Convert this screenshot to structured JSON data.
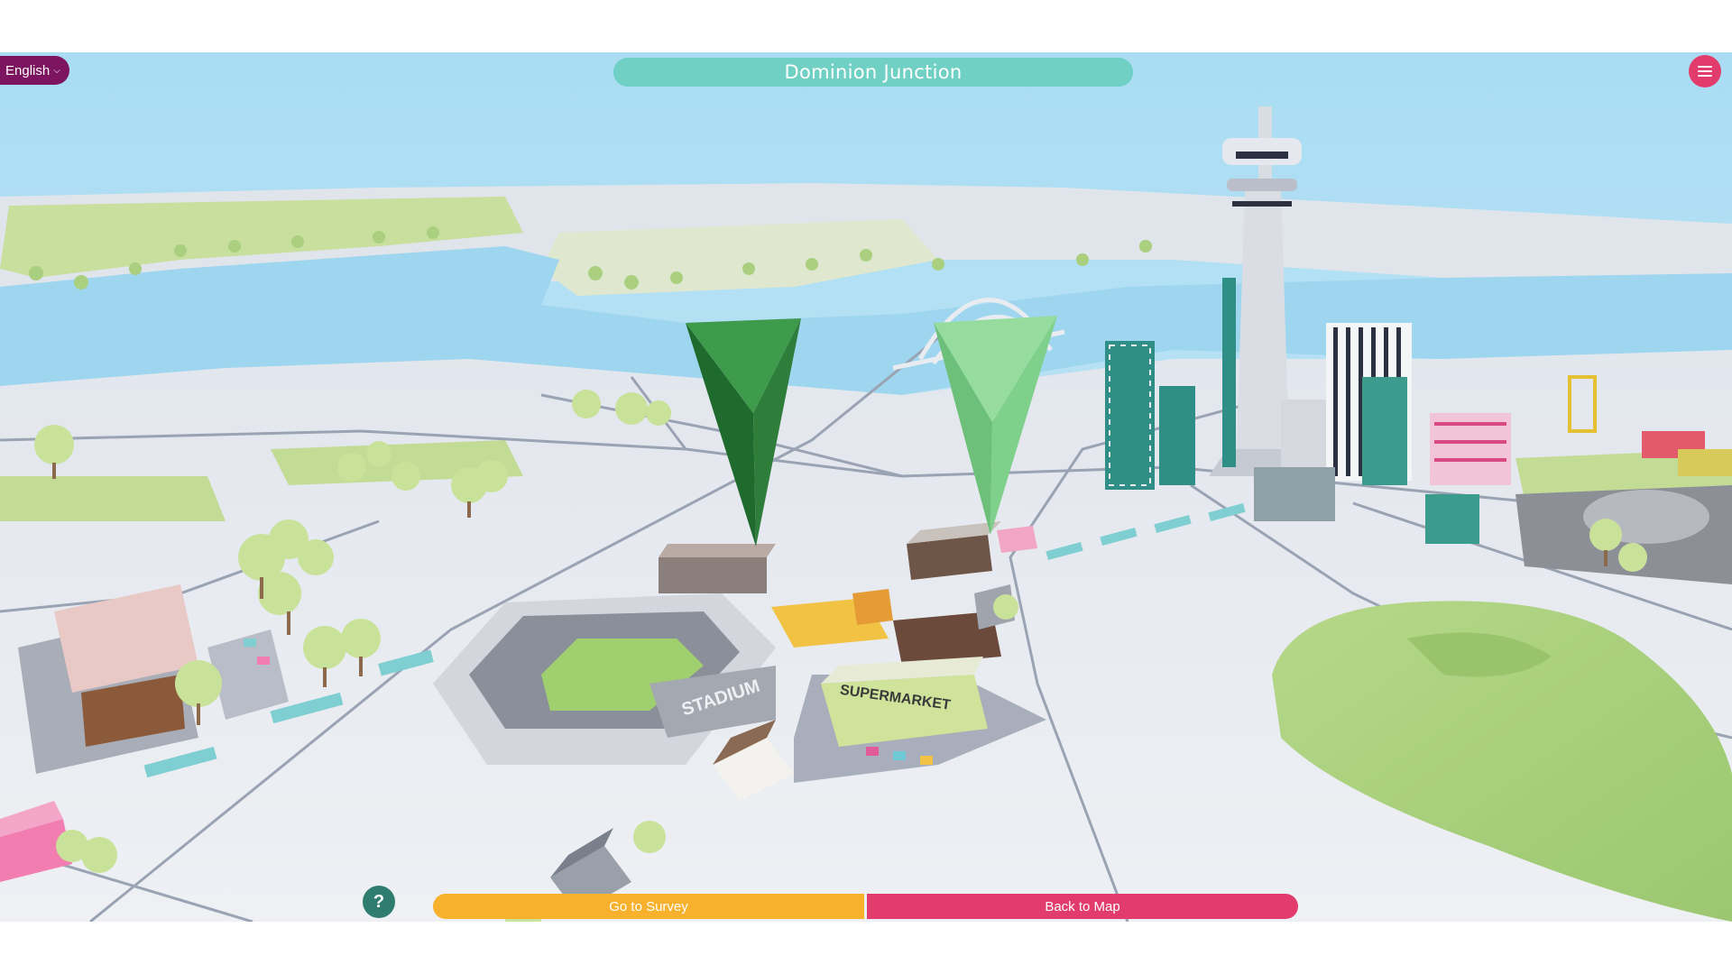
{
  "header": {
    "language": {
      "label": "English",
      "icon": "chevron-down-icon"
    },
    "title": "Dominion Junction",
    "menu": {
      "icon": "hamburger-menu-icon"
    }
  },
  "scene": {
    "buildings": {
      "stadium_sign": "STADIUM",
      "supermarket_sign": "SUPERMARKET"
    },
    "markers": [
      {
        "name": "marker-dark-green",
        "color": "#2e7d3a"
      },
      {
        "name": "marker-light-green",
        "color": "#7fd08a"
      }
    ]
  },
  "footer": {
    "help_label": "?",
    "go_to_survey_label": "Go to Survey",
    "back_to_map_label": "Back to Map"
  },
  "colors": {
    "title_banner": "#6fd0c3",
    "language_pill": "#7d1460",
    "menu_button": "#e23c6d",
    "survey_button": "#f8b12d",
    "back_button": "#e23c6d",
    "help_button": "#2f7d6f",
    "water": "#9fd6ef",
    "ground": "#e8ebf0",
    "grass": "#b9d98a"
  }
}
